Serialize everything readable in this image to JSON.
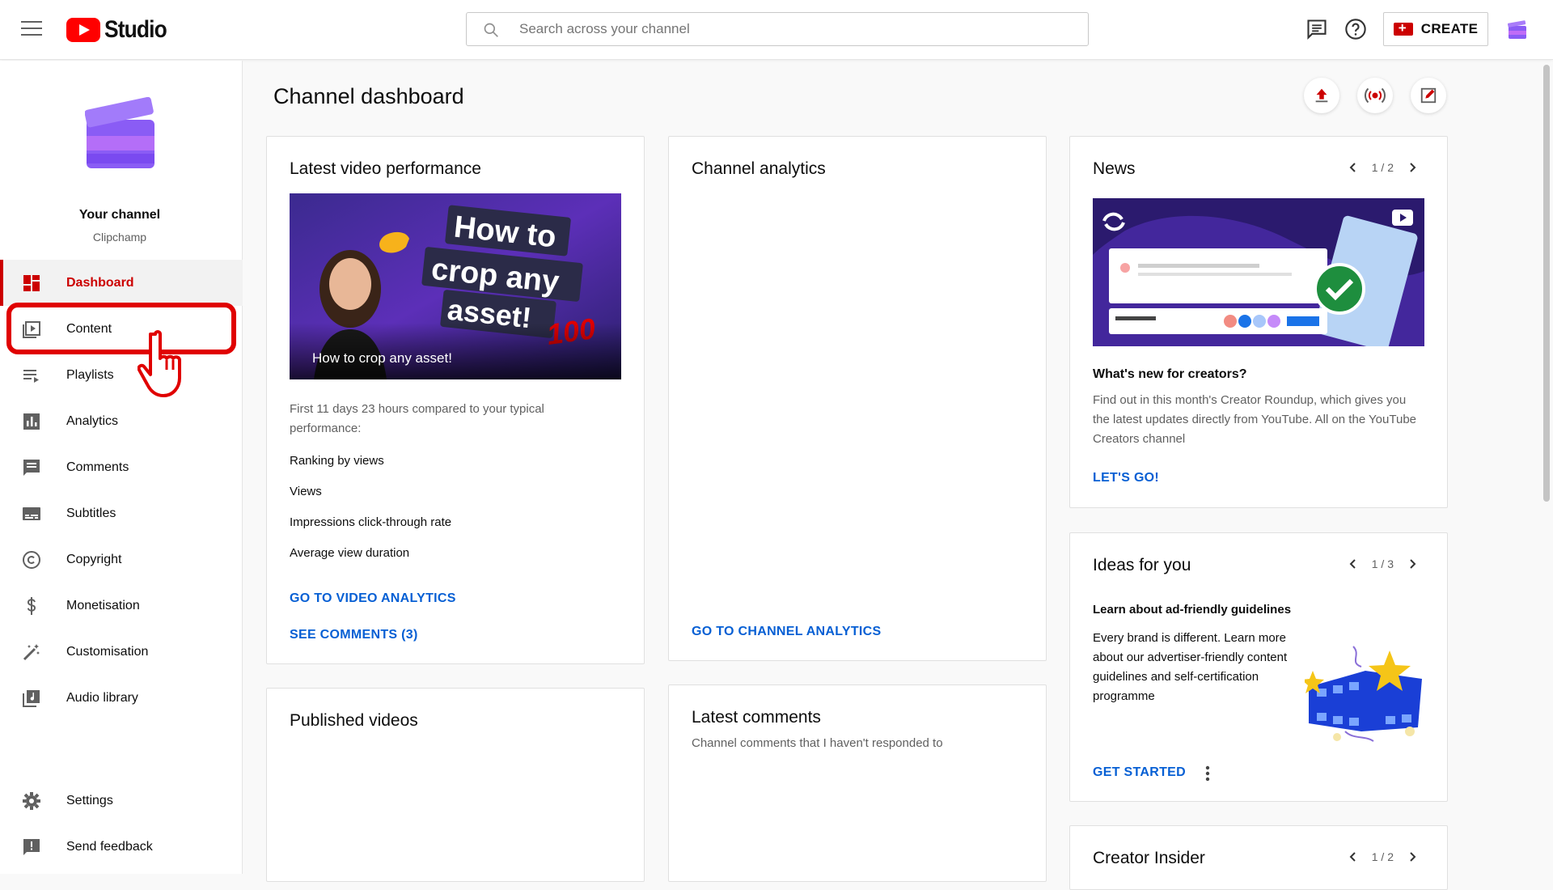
{
  "topbar": {
    "logo_text": "Studio",
    "search_placeholder": "Search across your channel",
    "create_label": "CREATE"
  },
  "sidebar": {
    "channel_name": "Your channel",
    "channel_handle": "Clipchamp",
    "items": [
      {
        "label": "Dashboard"
      },
      {
        "label": "Content"
      },
      {
        "label": "Playlists"
      },
      {
        "label": "Analytics"
      },
      {
        "label": "Comments"
      },
      {
        "label": "Subtitles"
      },
      {
        "label": "Copyright"
      },
      {
        "label": "Monetisation"
      },
      {
        "label": "Customisation"
      },
      {
        "label": "Audio library"
      }
    ],
    "bottom_items": [
      {
        "label": "Settings"
      },
      {
        "label": "Send feedback"
      }
    ]
  },
  "main": {
    "title": "Channel dashboard",
    "latest_video": {
      "title": "Latest video performance",
      "thumb_line1": "How to",
      "thumb_line2": "crop any",
      "thumb_line3": "asset!",
      "thumb_badge": "100",
      "video_title": "How to crop any asset!",
      "compare_text": "First 11 days 23 hours compared to your typical performance:",
      "metrics": [
        "Ranking by views",
        "Views",
        "Impressions click-through rate",
        "Average view duration"
      ],
      "link_analytics": "GO TO VIDEO ANALYTICS",
      "link_comments": "SEE COMMENTS (3)"
    },
    "channel_analytics": {
      "title": "Channel analytics",
      "link": "GO TO CHANNEL ANALYTICS"
    },
    "news": {
      "title": "News",
      "pager": "1 / 2",
      "headline": "What's new for creators?",
      "body": "Find out in this month's Creator Roundup, which gives you the latest updates directly from YouTube. All on the YouTube Creators channel",
      "link": "LET'S GO!"
    },
    "ideas": {
      "title": "Ideas for you",
      "pager": "1 / 3",
      "headline": "Learn about ad-friendly guidelines",
      "body": "Every brand is different. Learn more about our advertiser-friendly content guidelines and self-certification programme",
      "link": "GET STARTED"
    },
    "published": {
      "title": "Published videos"
    },
    "latest_comments": {
      "title": "Latest comments",
      "subtitle": "Channel comments that I haven't responded to"
    },
    "creator_insider": {
      "title": "Creator Insider",
      "pager": "1 / 2"
    }
  },
  "colors": {
    "brand_red": "#ff0000",
    "active_red": "#cc0000",
    "link_blue": "#065fd4",
    "highlight_red": "#e00000"
  }
}
